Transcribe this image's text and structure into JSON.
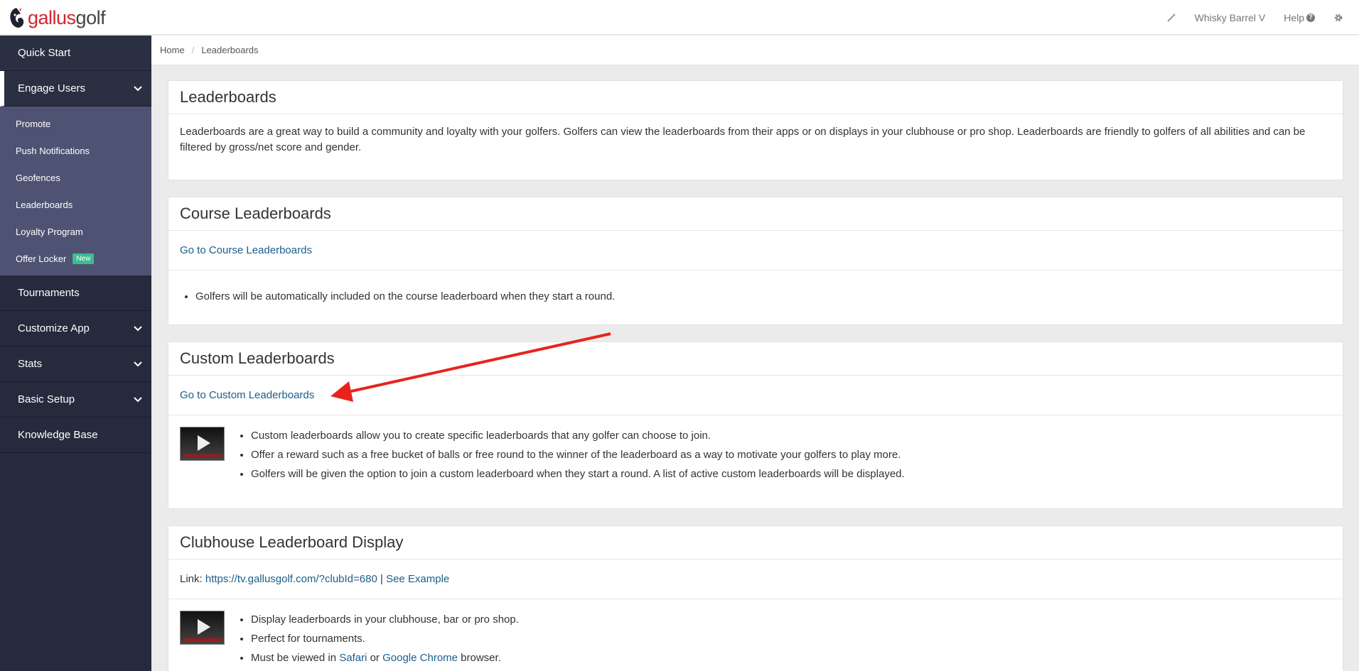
{
  "header": {
    "logo_part1": "gallus",
    "logo_part2": "golf",
    "club_name": "Whisky Barrel V",
    "help_label": "Help"
  },
  "sidebar": {
    "quick_start": "Quick Start",
    "engage_users": "Engage Users",
    "sub_items": [
      "Promote",
      "Push Notifications",
      "Geofences",
      "Leaderboards",
      "Loyalty Program",
      "Offer Locker"
    ],
    "new_badge": "New",
    "tournaments": "Tournaments",
    "customize_app": "Customize App",
    "stats": "Stats",
    "basic_setup": "Basic Setup",
    "knowledge_base": "Knowledge Base"
  },
  "breadcrumb": {
    "home": "Home",
    "sep": "/",
    "current": "Leaderboards"
  },
  "intro": {
    "title": "Leaderboards",
    "text": "Leaderboards are a great way to build a community and loyalty with your golfers. Golfers can view the leaderboards from their apps or on displays in your clubhouse or pro shop. Leaderboards are friendly to golfers of all abilities and can be filtered by gross/net score and gender."
  },
  "course": {
    "title": "Course Leaderboards",
    "link": "Go to Course Leaderboards",
    "bullets": [
      "Golfers will be automatically included on the course leaderboard when they start a round."
    ]
  },
  "custom": {
    "title": "Custom Leaderboards",
    "link": "Go to Custom Leaderboards",
    "bullets": [
      "Custom leaderboards allow you to create specific leaderboards that any golfer can choose to join.",
      "Offer a reward such as a free bucket of balls or free round to the winner of the leaderboard as a way to motivate your golfers to play more.",
      "Golfers will be given the option to join a custom leaderboard when they start a round. A list of active custom leaderboards will be displayed."
    ]
  },
  "clubhouse": {
    "title": "Clubhouse Leaderboard Display",
    "link_label": "Link:",
    "link_url": "https://tv.gallusgolf.com/?clubId=680",
    "pipe": "|",
    "see_example": "See Example",
    "bullet1": "Display leaderboards in your clubhouse, bar or pro shop.",
    "bullet2": "Perfect for tournaments.",
    "bullet3_pre": "Must be viewed in",
    "bullet3_safari": "Safari",
    "bullet3_or": "or",
    "bullet3_chrome": "Google Chrome",
    "bullet3_post": "browser."
  },
  "colors": {
    "sidebar_bg": "#252a3c",
    "subnav_bg": "#4e5373",
    "link": "#1a5e8a",
    "arrow": "#e8231d",
    "brand_red": "#d0262f"
  }
}
